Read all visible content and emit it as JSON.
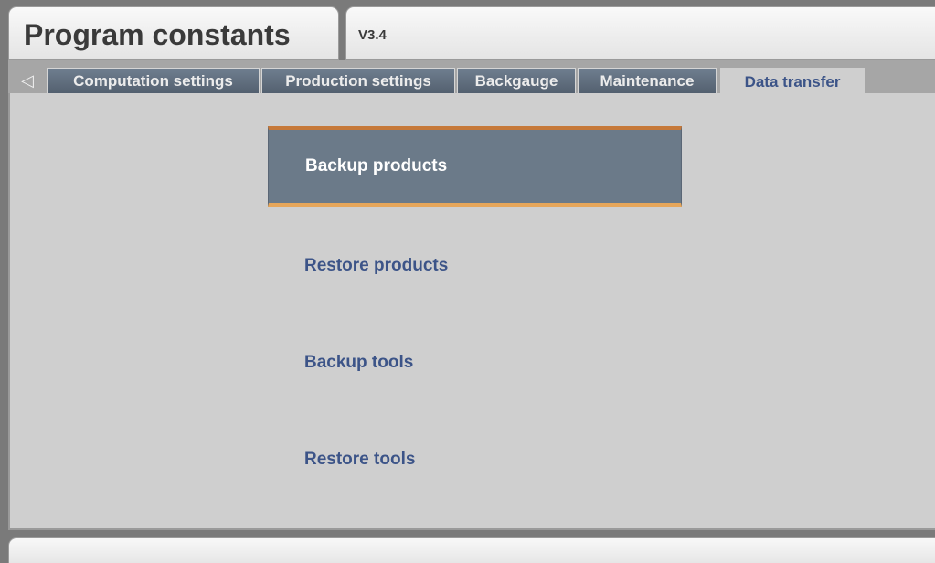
{
  "header": {
    "title": "Program constants",
    "version": "V3.4"
  },
  "tabs": [
    {
      "label": "Computation settings",
      "active": false
    },
    {
      "label": "Production settings",
      "active": false
    },
    {
      "label": "Backgauge",
      "active": false
    },
    {
      "label": "Maintenance",
      "active": false
    },
    {
      "label": "Data transfer",
      "active": true
    }
  ],
  "nav": {
    "back_icon": "◁"
  },
  "menu": [
    {
      "label": "Backup products",
      "selected": true
    },
    {
      "label": "Restore products",
      "selected": false
    },
    {
      "label": "Backup tools",
      "selected": false
    },
    {
      "label": "Restore tools",
      "selected": false
    }
  ],
  "colors": {
    "accent_text": "#3c5488",
    "tab_bg": "#5f6d7d",
    "selected_border": "#d48a45"
  }
}
